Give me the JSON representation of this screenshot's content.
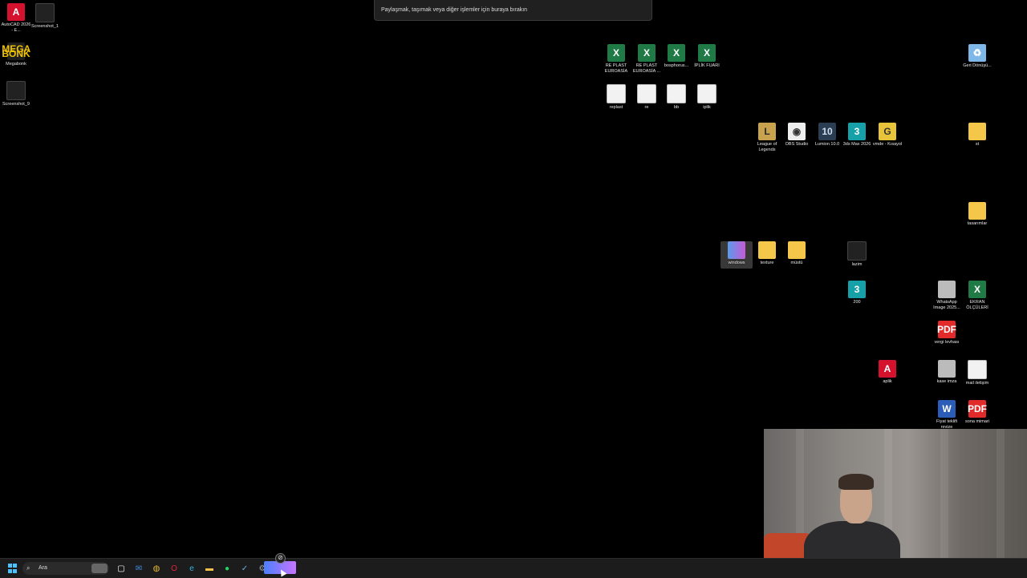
{
  "toast": {
    "text": "Paylaşmak, taşımak veya diğer işlemler için buraya bırakın"
  },
  "desktop": {
    "left_icons": [
      {
        "label": "AutoCAD 2026 - E...",
        "glyph": "A",
        "icon": "autocad-icon"
      },
      {
        "label": "Screenshot_1",
        "glyph": "",
        "icon": "screenshot-icon"
      },
      {
        "label": "Megabonk",
        "glyph": "MEGA BONK",
        "icon": "megabonk-icon"
      },
      {
        "label": "Screenshot_9",
        "glyph": "",
        "icon": "screenshot-icon"
      }
    ],
    "files_row1": [
      {
        "label": "RE PLAST EUROASİA",
        "glyph": "X"
      },
      {
        "label": "RE PLAST EUROASİA ...",
        "glyph": "X"
      },
      {
        "label": "bosphorus...",
        "glyph": "X"
      },
      {
        "label": "İPLİK FUARI",
        "glyph": "X"
      }
    ],
    "files_row2": [
      {
        "label": "replast"
      },
      {
        "label": "re"
      },
      {
        "label": "bb"
      },
      {
        "label": "iplik"
      }
    ],
    "apps_row": [
      {
        "label": "League of Legends",
        "glyph": "L",
        "icon": "league-of-legends-icon"
      },
      {
        "label": "OBS Studio",
        "glyph": "◉",
        "icon": "obs-studio-icon"
      },
      {
        "label": "Lumion 10.0",
        "glyph": "10",
        "icon": "lumion-icon"
      },
      {
        "label": "3ds Max 2026",
        "glyph": "3",
        "icon": "3ds-max-icon"
      },
      {
        "label": "vmde - Kısayol",
        "glyph": "G",
        "icon": "vmde-icon"
      }
    ],
    "right_icons": {
      "recycle_bin": "Geri Dönüşü...",
      "st": "st",
      "tasarimlar": "tasarımlar",
      "windows": "windows",
      "texture": "texture",
      "musto": "müstü",
      "lazim": "lazim",
      "max200": "200",
      "whatsapp": "WhatsApp Image 2025...",
      "ekran": "EKRAN ÖLÇÜLERİ",
      "vergi": "vergi levhası",
      "aplik": "aplik",
      "kase": "kase imza",
      "mail": "mail iletişim",
      "fiyat": "Fiyat teklifi revize",
      "sona": "sona mimari"
    },
    "glyphs": {
      "three": "3",
      "pdf": "PDF",
      "word": "W",
      "excel": "X",
      "fbx": "A",
      "bin": "♻"
    }
  },
  "taskbar": {
    "search_placeholder": "Ara",
    "apps": [
      {
        "name": "task-view-icon",
        "glyph": "▢"
      },
      {
        "name": "outlook-icon",
        "glyph": "✉"
      },
      {
        "name": "chrome-icon",
        "glyph": "◍"
      },
      {
        "name": "opera-icon",
        "glyph": "O"
      },
      {
        "name": "edge-icon",
        "glyph": "e"
      },
      {
        "name": "file-explorer-icon",
        "glyph": "▬"
      },
      {
        "name": "spotify-icon",
        "glyph": "●"
      },
      {
        "name": "steam-icon",
        "glyph": "✓"
      },
      {
        "name": "settings-icon",
        "glyph": "⚙"
      }
    ],
    "drag_glyph": "⊘"
  },
  "colors": {
    "taskbar_bg": "#1c1c1c",
    "accent": "#4cc2ff"
  }
}
